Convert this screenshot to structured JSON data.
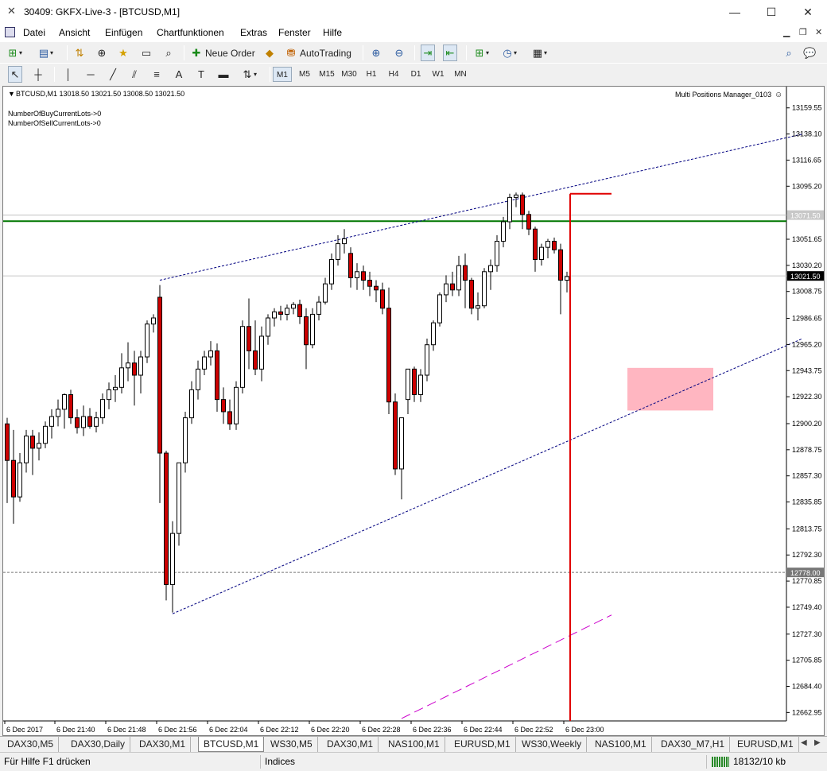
{
  "window": {
    "title": "30409: GKFX-Live-3 - [BTCUSD,M1]",
    "minimize": "—",
    "maximize": "☐",
    "close": "✕"
  },
  "menu": {
    "items": [
      "Datei",
      "Ansicht",
      "Einfügen",
      "Chartfunktionen",
      "Extras",
      "Fenster",
      "Hilfe"
    ]
  },
  "toolbar": {
    "new_order": "Neue Order",
    "auto_trading": "AutoTrading",
    "timeframes": [
      "M1",
      "M5",
      "M15",
      "M30",
      "H1",
      "H4",
      "D1",
      "W1",
      "MN"
    ]
  },
  "chart": {
    "header": "BTCUSD,M1  13018.50 13021.50 13008.50 13021.50",
    "expert_name": "Multi Positions Manager_0103",
    "info_lines": [
      "NumberOfBuyCurrentLots->0",
      "NumberOfSellCurrentLots->0"
    ],
    "bid_label": "13021.50",
    "level_label_1": "13071.50",
    "level_label_2": "12778.00",
    "colors": {
      "bull_body": "#ffffff",
      "bear_body": "#cc0000",
      "candle_wick": "#000000",
      "green_line": "#007700",
      "red_marker": "#e00000",
      "trend_line": "#000080",
      "magenta_line": "#cc00cc",
      "pink_zone": "#ffb6c1"
    }
  },
  "chart_data": {
    "type": "candlestick",
    "symbol": "BTCUSD",
    "timeframe": "M1",
    "ylim": [
      12656,
      13177
    ],
    "y_ticks": [
      13159.55,
      13138.1,
      13116.65,
      13095.2,
      13051.65,
      13030.2,
      13008.75,
      12986.65,
      12965.2,
      12943.75,
      12922.3,
      12900.2,
      12878.75,
      12857.3,
      12835.85,
      12813.75,
      12792.3,
      12770.85,
      12749.4,
      12727.3,
      12705.85,
      12684.4,
      12662.95
    ],
    "x_ticks": [
      "6 Dec 2017",
      "6 Dec 21:40",
      "6 Dec 21:48",
      "6 Dec 21:56",
      "6 Dec 22:04",
      "6 Dec 22:12",
      "6 Dec 22:20",
      "6 Dec 22:28",
      "6 Dec 22:36",
      "6 Dec 22:44",
      "6 Dec 22:52",
      "6 Dec 23:00"
    ],
    "horizontal_levels": [
      13071.5,
      13066.5,
      13021.5,
      12778.0
    ],
    "candles": [
      {
        "o": 12900,
        "h": 12905,
        "l": 12835,
        "c": 12870
      },
      {
        "o": 12870,
        "h": 12895,
        "l": 12818,
        "c": 12840
      },
      {
        "o": 12840,
        "h": 12876,
        "l": 12836,
        "c": 12868
      },
      {
        "o": 12868,
        "h": 12895,
        "l": 12860,
        "c": 12890
      },
      {
        "o": 12890,
        "h": 12895,
        "l": 12858,
        "c": 12880
      },
      {
        "o": 12880,
        "h": 12893,
        "l": 12870,
        "c": 12884
      },
      {
        "o": 12884,
        "h": 12902,
        "l": 12880,
        "c": 12898
      },
      {
        "o": 12898,
        "h": 12912,
        "l": 12888,
        "c": 12906
      },
      {
        "o": 12906,
        "h": 12920,
        "l": 12898,
        "c": 12912
      },
      {
        "o": 12912,
        "h": 12925,
        "l": 12896,
        "c": 12924
      },
      {
        "o": 12924,
        "h": 12928,
        "l": 12900,
        "c": 12905
      },
      {
        "o": 12905,
        "h": 12912,
        "l": 12892,
        "c": 12897
      },
      {
        "o": 12897,
        "h": 12915,
        "l": 12890,
        "c": 12906
      },
      {
        "o": 12906,
        "h": 12913,
        "l": 12896,
        "c": 12898
      },
      {
        "o": 12898,
        "h": 12910,
        "l": 12893,
        "c": 12905
      },
      {
        "o": 12905,
        "h": 12925,
        "l": 12900,
        "c": 12920
      },
      {
        "o": 12920,
        "h": 12934,
        "l": 12912,
        "c": 12928
      },
      {
        "o": 12928,
        "h": 12940,
        "l": 12918,
        "c": 12930
      },
      {
        "o": 12930,
        "h": 12958,
        "l": 12925,
        "c": 12946
      },
      {
        "o": 12946,
        "h": 12967,
        "l": 12935,
        "c": 12950
      },
      {
        "o": 12950,
        "h": 12960,
        "l": 12915,
        "c": 12940
      },
      {
        "o": 12940,
        "h": 12960,
        "l": 12925,
        "c": 12955
      },
      {
        "o": 12955,
        "h": 12985,
        "l": 12950,
        "c": 12982
      },
      {
        "o": 12982,
        "h": 12990,
        "l": 12975,
        "c": 12987
      },
      {
        "o": 13004,
        "h": 13014,
        "l": 12835,
        "c": 12876
      },
      {
        "o": 12876,
        "h": 12878,
        "l": 12755,
        "c": 12768
      },
      {
        "o": 12768,
        "h": 12820,
        "l": 12745,
        "c": 12810
      },
      {
        "o": 12810,
        "h": 12860,
        "l": 12800,
        "c": 12868
      },
      {
        "o": 12868,
        "h": 12910,
        "l": 12860,
        "c": 12905
      },
      {
        "o": 12905,
        "h": 12935,
        "l": 12900,
        "c": 12928
      },
      {
        "o": 12928,
        "h": 12952,
        "l": 12920,
        "c": 12945
      },
      {
        "o": 12945,
        "h": 12960,
        "l": 12940,
        "c": 12955
      },
      {
        "o": 12955,
        "h": 12968,
        "l": 12948,
        "c": 12960
      },
      {
        "o": 12960,
        "h": 12966,
        "l": 12910,
        "c": 12920
      },
      {
        "o": 12920,
        "h": 12930,
        "l": 12900,
        "c": 12910
      },
      {
        "o": 12910,
        "h": 12920,
        "l": 12895,
        "c": 12900
      },
      {
        "o": 12900,
        "h": 12935,
        "l": 12895,
        "c": 12930
      },
      {
        "o": 12930,
        "h": 12985,
        "l": 12925,
        "c": 12980
      },
      {
        "o": 12980,
        "h": 13003,
        "l": 12945,
        "c": 12960
      },
      {
        "o": 12960,
        "h": 12985,
        "l": 12940,
        "c": 12945
      },
      {
        "o": 12945,
        "h": 12980,
        "l": 12935,
        "c": 12972
      },
      {
        "o": 12972,
        "h": 12990,
        "l": 12965,
        "c": 12987
      },
      {
        "o": 12987,
        "h": 12995,
        "l": 12980,
        "c": 12992
      },
      {
        "o": 12992,
        "h": 12997,
        "l": 12985,
        "c": 12990
      },
      {
        "o": 12990,
        "h": 12998,
        "l": 12985,
        "c": 12995
      },
      {
        "o": 12995,
        "h": 13000,
        "l": 12990,
        "c": 12998
      },
      {
        "o": 12998,
        "h": 13002,
        "l": 12982,
        "c": 12988
      },
      {
        "o": 12988,
        "h": 12995,
        "l": 12945,
        "c": 12965
      },
      {
        "o": 12965,
        "h": 12995,
        "l": 12962,
        "c": 12990
      },
      {
        "o": 12990,
        "h": 13005,
        "l": 12985,
        "c": 13000
      },
      {
        "o": 13000,
        "h": 13020,
        "l": 12998,
        "c": 13015
      },
      {
        "o": 13015,
        "h": 13040,
        "l": 13010,
        "c": 13035
      },
      {
        "o": 13035,
        "h": 13055,
        "l": 13030,
        "c": 13048
      },
      {
        "o": 13048,
        "h": 13060,
        "l": 13040,
        "c": 13052
      },
      {
        "o": 13040,
        "h": 13045,
        "l": 13012,
        "c": 13020
      },
      {
        "o": 13020,
        "h": 13032,
        "l": 13010,
        "c": 13025
      },
      {
        "o": 13025,
        "h": 13030,
        "l": 13010,
        "c": 13018
      },
      {
        "o": 13018,
        "h": 13025,
        "l": 13005,
        "c": 13013
      },
      {
        "o": 13013,
        "h": 13018,
        "l": 13000,
        "c": 13010
      },
      {
        "o": 13010,
        "h": 13016,
        "l": 12990,
        "c": 12995
      },
      {
        "o": 12995,
        "h": 13012,
        "l": 12908,
        "c": 12918
      },
      {
        "o": 12918,
        "h": 12925,
        "l": 12858,
        "c": 12863
      },
      {
        "o": 12863,
        "h": 12905,
        "l": 12838,
        "c": 12905
      },
      {
        "o": 12920,
        "h": 12945,
        "l": 12908,
        "c": 12945
      },
      {
        "o": 12945,
        "h": 12947,
        "l": 12918,
        "c": 12924
      },
      {
        "o": 12924,
        "h": 12945,
        "l": 12918,
        "c": 12940
      },
      {
        "o": 12940,
        "h": 12970,
        "l": 12935,
        "c": 12965
      },
      {
        "o": 12965,
        "h": 12985,
        "l": 12960,
        "c": 12983
      },
      {
        "o": 12983,
        "h": 13008,
        "l": 12980,
        "c": 13006
      },
      {
        "o": 13006,
        "h": 13022,
        "l": 13000,
        "c": 13015
      },
      {
        "o": 13015,
        "h": 13025,
        "l": 13005,
        "c": 13010
      },
      {
        "o": 13010,
        "h": 13038,
        "l": 13005,
        "c": 13030
      },
      {
        "o": 13030,
        "h": 13040,
        "l": 12995,
        "c": 13018
      },
      {
        "o": 13018,
        "h": 13020,
        "l": 12990,
        "c": 12995
      },
      {
        "o": 12995,
        "h": 13008,
        "l": 12985,
        "c": 12997
      },
      {
        "o": 12997,
        "h": 13028,
        "l": 12995,
        "c": 13025
      },
      {
        "o": 13025,
        "h": 13035,
        "l": 13010,
        "c": 13030
      },
      {
        "o": 13030,
        "h": 13055,
        "l": 13025,
        "c": 13050
      },
      {
        "o": 13050,
        "h": 13070,
        "l": 13045,
        "c": 13066
      },
      {
        "o": 13066,
        "h": 13089,
        "l": 13060,
        "c": 13086
      },
      {
        "o": 13086,
        "h": 13090,
        "l": 13078,
        "c": 13088
      },
      {
        "o": 13088,
        "h": 13090,
        "l": 13060,
        "c": 13072
      },
      {
        "o": 13072,
        "h": 13075,
        "l": 13055,
        "c": 13060
      },
      {
        "o": 13060,
        "h": 13062,
        "l": 13025,
        "c": 13035
      },
      {
        "o": 13035,
        "h": 13048,
        "l": 13030,
        "c": 13045
      },
      {
        "o": 13045,
        "h": 13052,
        "l": 13036,
        "c": 13050
      },
      {
        "o": 13050,
        "h": 13053,
        "l": 13040,
        "c": 13043
      },
      {
        "o": 13043,
        "h": 13048,
        "l": 12990,
        "c": 13018
      },
      {
        "o": 13018,
        "h": 13025,
        "l": 13008,
        "c": 13021
      }
    ],
    "objects": {
      "upper_trendline": {
        "from": [
          24,
          13018
        ],
        "to": [
          125,
          13138
        ]
      },
      "lower_trendline": {
        "from": [
          26,
          12744
        ],
        "to": [
          125,
          12970
        ]
      },
      "magenta_trendline": {
        "from": [
          62,
          12658
        ],
        "to": [
          95,
          12743
        ]
      },
      "red_vertical_line": {
        "x": 88.5
      },
      "red_hline_segment": {
        "y": 13089,
        "from": 88.5,
        "to": 95
      },
      "pink_zone": {
        "from": [
          97.5,
          12946
        ],
        "to": [
          111,
          12911
        ]
      }
    }
  },
  "tabs": {
    "items": [
      "DAX30,M5",
      "DAX30,Daily",
      "DAX30,M1",
      "BTCUSD,M1",
      "WS30,M5",
      "DAX30,M1",
      "NAS100,M1",
      "EURUSD,M1",
      "WS30,Weekly",
      "NAS100,M1",
      "DAX30_M7,H1",
      "EURUSD,M1"
    ],
    "active_index": 3
  },
  "status": {
    "help": "Für Hilfe F1 drücken",
    "profile": "Indices",
    "connection": "18132/10 kb"
  }
}
